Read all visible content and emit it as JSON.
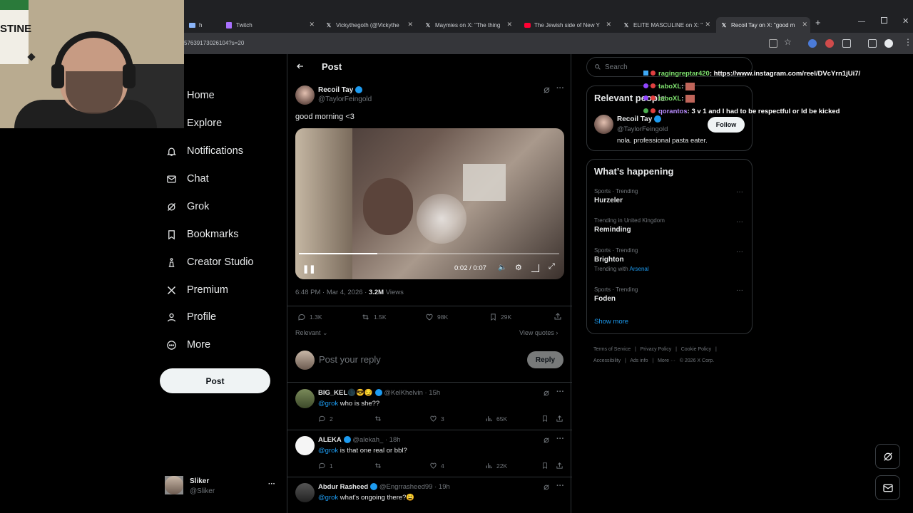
{
  "browser": {
    "tabs": [
      {
        "title": "h",
        "favicon": "tv-icon"
      },
      {
        "title": "Twitch",
        "favicon": "twitch-icon"
      },
      {
        "title": "Vickythegoth (@Vickythe",
        "favicon": "x-icon"
      },
      {
        "title": "Maymies on X: \"The thing",
        "favicon": "x-icon"
      },
      {
        "title": "The Jewish side of New Y",
        "favicon": "youtube-icon"
      },
      {
        "title": "ELITE MASCULINE on X: \"",
        "favicon": "x-icon"
      },
      {
        "title": "Recoil Tay on X: \"good m",
        "favicon": "x-icon"
      }
    ],
    "url": "57639173026104?s=20"
  },
  "nav": {
    "items": [
      {
        "label": "Home",
        "icon": "home-icon"
      },
      {
        "label": "Explore",
        "icon": "search-icon"
      },
      {
        "label": "Notifications",
        "icon": "bell-icon"
      },
      {
        "label": "Chat",
        "icon": "mail-icon"
      },
      {
        "label": "Grok",
        "icon": "grok-icon"
      },
      {
        "label": "Bookmarks",
        "icon": "bookmark-icon"
      },
      {
        "label": "Creator Studio",
        "icon": "creator-icon"
      },
      {
        "label": "Premium",
        "icon": "x-logo-icon"
      },
      {
        "label": "Profile",
        "icon": "person-icon"
      },
      {
        "label": "More",
        "icon": "more-circle-icon"
      }
    ],
    "post_button": "Post",
    "account": {
      "name": "Sliker",
      "handle": "@Sliker",
      "more": "···"
    }
  },
  "header": {
    "title": "Post"
  },
  "post": {
    "author": "Recoil Tay",
    "handle": "@TaylorFeingold",
    "text": "good morning <3",
    "video": {
      "time": "0:02 / 0:07",
      "progress": 0.3
    },
    "timestamp": "6:48 PM · Mar 4, 2026 · ",
    "views_count": "3.2M",
    "views_label": " Views",
    "stats": {
      "replies": "1.3K",
      "reposts": "1.5K",
      "likes": "98K",
      "bookmarks": "29K"
    },
    "sort": "Relevant",
    "view_quotes": "View quotes",
    "reply_placeholder": "Post your reply",
    "reply_button": "Reply"
  },
  "replies": [
    {
      "name": "BIG_KEL",
      "emoji": "🌑😎😏",
      "handle": "@KelKhelvin · 15h",
      "mention": "@grok",
      "text": " who is she??",
      "replies": "2",
      "reposts": "",
      "likes": "3",
      "views": "65K"
    },
    {
      "name": "ALEKA",
      "emoji": "",
      "handle": "@alekah_ · 18h",
      "mention": "@grok",
      "text": " is that one real or bbl?",
      "replies": "1",
      "reposts": "",
      "likes": "4",
      "views": "22K"
    },
    {
      "name": "Abdur Rasheed",
      "emoji": "",
      "handle": "@Engrrasheed99 · 19h",
      "mention": "@grok",
      "text": " what's ongoing there?😩",
      "replies": "",
      "reposts": "",
      "likes": "",
      "views": ""
    }
  ],
  "right": {
    "search_placeholder": "Search",
    "relevant_title": "Relevant people",
    "person": {
      "name": "Recoil Tay",
      "handle": "@TaylorFeingold",
      "bio": "nola. professional pasta eater.",
      "follow": "Follow"
    },
    "happening_title": "What’s happening",
    "trends": [
      {
        "meta": "Sports · Trending",
        "name": "Hurzeler",
        "extra": "",
        "extra_link": ""
      },
      {
        "meta": "Trending in United Kingdom",
        "name": "Reminding",
        "extra": "",
        "extra_link": ""
      },
      {
        "meta": "Sports · Trending",
        "name": "Brighton",
        "extra": "Trending with ",
        "extra_link": "Arsenal"
      },
      {
        "meta": "Sports · Trending",
        "name": "Foden",
        "extra": "",
        "extra_link": ""
      }
    ],
    "show_more": "Show more",
    "footer": [
      "Terms of Service",
      "|",
      "Privacy Policy",
      "|",
      "Cookie Policy",
      "|",
      "Accessibility",
      "|",
      "Ads info",
      "|",
      "More ···",
      "© 2026 X Corp."
    ]
  },
  "chat_overlay": [
    {
      "name": "ragingreptar420",
      "text": ": https://www.instagram.com/reel/DVcYrn1jUi7/",
      "color": "#7ee16e"
    },
    {
      "name": "taboXL",
      "text": ":",
      "color": "#7ee16e"
    },
    {
      "name": "taboXL",
      "text": ":",
      "color": "#7ee16e"
    },
    {
      "name": "qorantos",
      "text": ": 3 v 1 and I had to be respectful or Id be kicked",
      "color": "#b98cff"
    }
  ],
  "webcam": {
    "sign_text": "STINE"
  },
  "colors": {
    "accent": "#1d9bf0",
    "border": "#2f3336",
    "muted": "#71767b"
  }
}
